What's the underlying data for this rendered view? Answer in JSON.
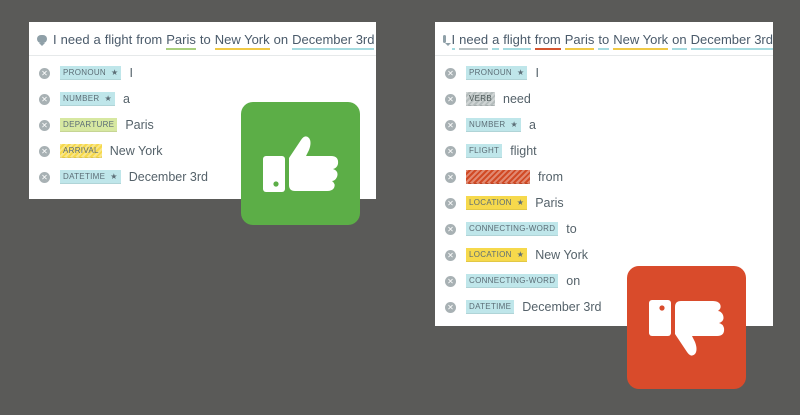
{
  "left_panel": {
    "query_tokens": [
      {
        "text": "I",
        "u": "none"
      },
      {
        "text": "need",
        "u": "none"
      },
      {
        "text": "a",
        "u": "none"
      },
      {
        "text": "flight",
        "u": "none"
      },
      {
        "text": "from",
        "u": "none"
      },
      {
        "text": "Paris",
        "u": "green"
      },
      {
        "text": "to",
        "u": "none"
      },
      {
        "text": "New York",
        "u": "yellow"
      },
      {
        "text": "on",
        "u": "none"
      },
      {
        "text": "December 3rd",
        "u": "teal"
      }
    ],
    "entities": [
      {
        "tag": "PRONOUN",
        "color": "teal",
        "star": true,
        "value": "I"
      },
      {
        "tag": "NUMBER",
        "color": "teal",
        "star": true,
        "value": "a"
      },
      {
        "tag": "DEPARTURE",
        "color": "green",
        "star": false,
        "value": "Paris"
      },
      {
        "tag": "ARRIVAL",
        "color": "yellow",
        "star": false,
        "hatch": true,
        "value": "New York"
      },
      {
        "tag": "DATETIME",
        "color": "teal",
        "star": true,
        "value": "December 3rd"
      }
    ]
  },
  "right_panel": {
    "query_tokens": [
      {
        "text": "I",
        "u": "teal"
      },
      {
        "text": "need",
        "u": "gray"
      },
      {
        "text": "a",
        "u": "teal"
      },
      {
        "text": "flight",
        "u": "teal"
      },
      {
        "text": "from",
        "u": "red"
      },
      {
        "text": "Paris",
        "u": "yellow"
      },
      {
        "text": "to",
        "u": "teal"
      },
      {
        "text": "New York",
        "u": "yellow"
      },
      {
        "text": "on",
        "u": "teal"
      },
      {
        "text": "December 3rd",
        "u": "teal"
      }
    ],
    "entities": [
      {
        "tag": "PRONOUN",
        "color": "teal",
        "star": true,
        "value": "I"
      },
      {
        "tag": "VERB",
        "color": "gray",
        "star": false,
        "hatch": true,
        "value": "need"
      },
      {
        "tag": "NUMBER",
        "color": "teal",
        "star": true,
        "value": "a"
      },
      {
        "tag": "FLIGHT",
        "color": "teal",
        "star": false,
        "value": "flight"
      },
      {
        "tag": "",
        "color": "red",
        "star": false,
        "hatch": true,
        "value": "from"
      },
      {
        "tag": "LOCATION",
        "color": "yellow",
        "star": true,
        "value": "Paris"
      },
      {
        "tag": "CONNECTING-WORD",
        "color": "teal",
        "star": false,
        "value": "to"
      },
      {
        "tag": "LOCATION",
        "color": "yellow",
        "star": true,
        "value": "New York"
      },
      {
        "tag": "CONNECTING-WORD",
        "color": "teal",
        "star": false,
        "value": "on"
      },
      {
        "tag": "DATETIME",
        "color": "teal",
        "star": false,
        "value": "December 3rd"
      }
    ]
  },
  "icons": {
    "remove": "close-circle-icon",
    "query": "speech-bubble-icon",
    "star": "★",
    "thumbs_up": "thumbs-up-icon",
    "thumbs_down": "thumbs-down-icon"
  },
  "colors": {
    "background": "#5a5a58",
    "thumbs_up_bg": "#5cae47",
    "thumbs_down_bg": "#d94b2b",
    "teal_tag": "#bfe6ea",
    "yellow_tag": "#f6d94c",
    "green_tag": "#d7e8a1",
    "red_tag": "#d14a25"
  }
}
